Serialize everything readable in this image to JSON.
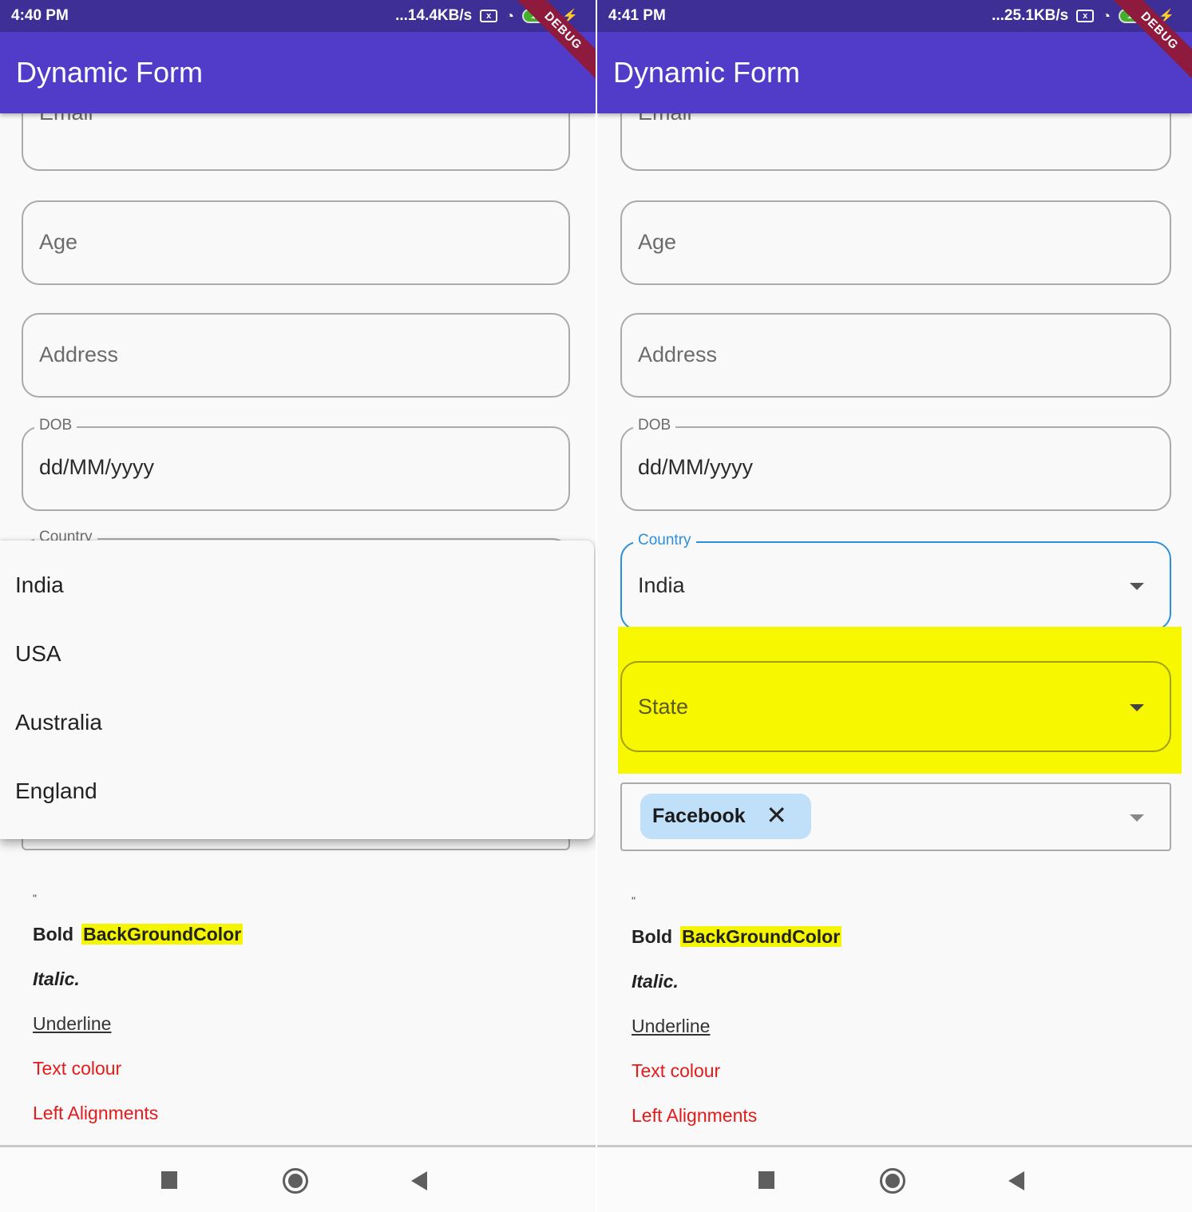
{
  "screens": [
    {
      "status": {
        "time": "4:40 PM",
        "net_speed": "...14.4KB/s",
        "battery": "100"
      },
      "app_title": "Dynamic Form",
      "debug_banner": "DEBUG",
      "fields": {
        "email": {
          "placeholder": "Email"
        },
        "age": {
          "placeholder": "Age"
        },
        "address": {
          "placeholder": "Address"
        },
        "dob": {
          "label": "DOB",
          "value": "dd/MM/yyyy"
        },
        "country": {
          "label": "Country"
        }
      },
      "country_menu": {
        "options": [
          "India",
          "USA",
          "Australia",
          "England"
        ]
      },
      "rich_text": {
        "quote": "\"",
        "bold": "Bold",
        "background": "BackGroundColor",
        "italic": "Italic.",
        "underline": "Underline",
        "text_colour": "Text colour",
        "left_align": "Left Alignments"
      }
    },
    {
      "status": {
        "time": "4:41 PM",
        "net_speed": "...25.1KB/s",
        "battery": "100"
      },
      "app_title": "Dynamic Form",
      "debug_banner": "DEBUG",
      "fields": {
        "email": {
          "placeholder": "Email"
        },
        "age": {
          "placeholder": "Age"
        },
        "address": {
          "placeholder": "Address"
        },
        "dob": {
          "label": "DOB",
          "value": "dd/MM/yyyy"
        },
        "country": {
          "label": "Country",
          "value": "India"
        },
        "state": {
          "placeholder": "State"
        },
        "social": {
          "chips": [
            "Facebook"
          ]
        }
      },
      "rich_text": {
        "quote": "\"",
        "bold": "Bold",
        "background": "BackGroundColor",
        "italic": "Italic.",
        "underline": "Underline",
        "text_colour": "Text colour",
        "left_align": "Left Alignments"
      }
    }
  ],
  "colors": {
    "app_bar": "#503cc8",
    "status_bar": "#3d2f96",
    "focus_blue": "#2d8fdc",
    "highlight_yellow": "#f7f700",
    "chip_bg": "#bfe0f8",
    "red_text": "#e51a1a"
  }
}
